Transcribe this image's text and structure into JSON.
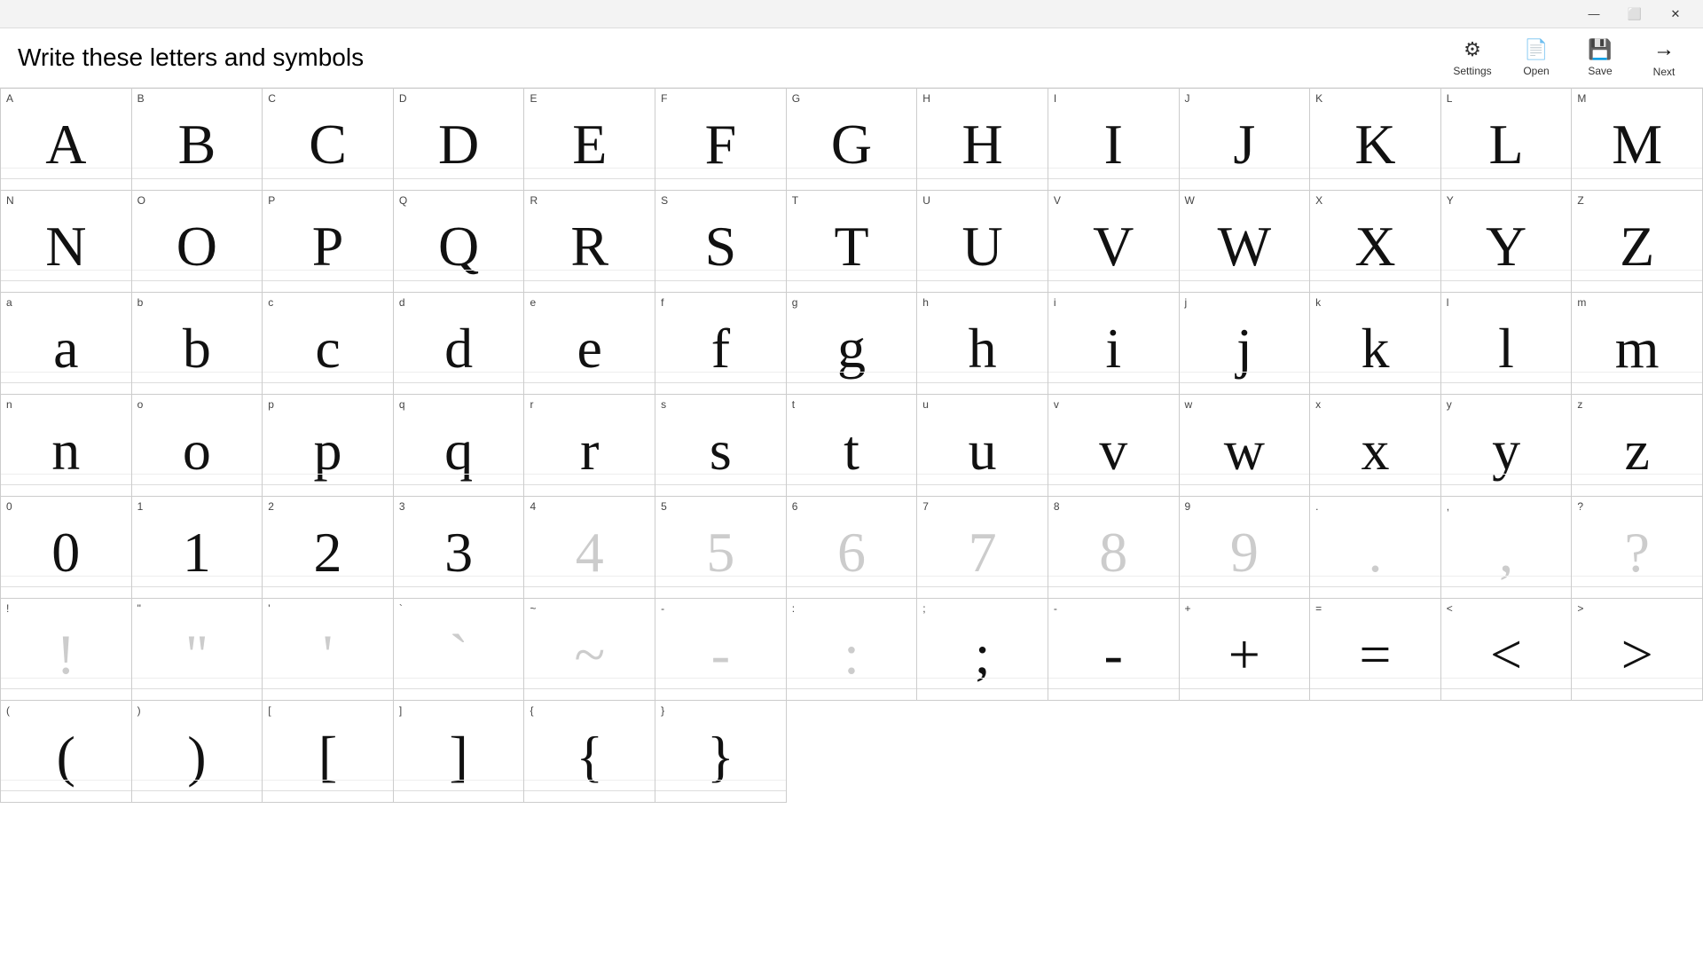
{
  "window": {
    "title": "Write these letters and symbols",
    "titlebar": {
      "minimize": "—",
      "maximize": "⬜",
      "close": "✕"
    }
  },
  "toolbar": {
    "settings_label": "Settings",
    "open_label": "Open",
    "save_label": "Save",
    "next_label": "Next"
  },
  "cells": [
    {
      "label": "A",
      "glyph": "A",
      "faded": false
    },
    {
      "label": "B",
      "glyph": "B",
      "faded": false
    },
    {
      "label": "C",
      "glyph": "C",
      "faded": false
    },
    {
      "label": "D",
      "glyph": "D",
      "faded": false
    },
    {
      "label": "E",
      "glyph": "E",
      "faded": false
    },
    {
      "label": "F",
      "glyph": "F",
      "faded": false
    },
    {
      "label": "G",
      "glyph": "G",
      "faded": false
    },
    {
      "label": "H",
      "glyph": "H",
      "faded": false
    },
    {
      "label": "I",
      "glyph": "I",
      "faded": false
    },
    {
      "label": "J",
      "glyph": "J",
      "faded": false
    },
    {
      "label": "K",
      "glyph": "K",
      "faded": false
    },
    {
      "label": "L",
      "glyph": "L",
      "faded": false
    },
    {
      "label": "M",
      "glyph": "M",
      "faded": false
    },
    {
      "label": "N",
      "glyph": "N",
      "faded": false
    },
    {
      "label": "O",
      "glyph": "O",
      "faded": false
    },
    {
      "label": "P",
      "glyph": "P",
      "faded": false
    },
    {
      "label": "Q",
      "glyph": "Q",
      "faded": false
    },
    {
      "label": "R",
      "glyph": "R",
      "faded": false
    },
    {
      "label": "S",
      "glyph": "S",
      "faded": false
    },
    {
      "label": "T",
      "glyph": "T",
      "faded": false
    },
    {
      "label": "U",
      "glyph": "U",
      "faded": false
    },
    {
      "label": "V",
      "glyph": "V",
      "faded": false
    },
    {
      "label": "W",
      "glyph": "W",
      "faded": false
    },
    {
      "label": "X",
      "glyph": "X",
      "faded": false
    },
    {
      "label": "Y",
      "glyph": "Y",
      "faded": false
    },
    {
      "label": "Z",
      "glyph": "Z",
      "faded": false
    },
    {
      "label": "a",
      "glyph": "a",
      "faded": false
    },
    {
      "label": "b",
      "glyph": "b",
      "faded": false
    },
    {
      "label": "c",
      "glyph": "c",
      "faded": false
    },
    {
      "label": "d",
      "glyph": "d",
      "faded": false
    },
    {
      "label": "e",
      "glyph": "e",
      "faded": false
    },
    {
      "label": "f",
      "glyph": "f",
      "faded": false
    },
    {
      "label": "g",
      "glyph": "g",
      "faded": false
    },
    {
      "label": "h",
      "glyph": "h",
      "faded": false
    },
    {
      "label": "i",
      "glyph": "i",
      "faded": false
    },
    {
      "label": "j",
      "glyph": "j",
      "faded": false
    },
    {
      "label": "k",
      "glyph": "k",
      "faded": false
    },
    {
      "label": "l",
      "glyph": "l",
      "faded": false
    },
    {
      "label": "m",
      "glyph": "m",
      "faded": false
    },
    {
      "label": "n",
      "glyph": "n",
      "faded": false
    },
    {
      "label": "o",
      "glyph": "o",
      "faded": false
    },
    {
      "label": "p",
      "glyph": "p",
      "faded": false
    },
    {
      "label": "q",
      "glyph": "q",
      "faded": false
    },
    {
      "label": "r",
      "glyph": "r",
      "faded": false
    },
    {
      "label": "s",
      "glyph": "s",
      "faded": false
    },
    {
      "label": "t",
      "glyph": "t",
      "faded": false
    },
    {
      "label": "u",
      "glyph": "u",
      "faded": false
    },
    {
      "label": "v",
      "glyph": "v",
      "faded": false
    },
    {
      "label": "w",
      "glyph": "w",
      "faded": false
    },
    {
      "label": "x",
      "glyph": "x",
      "faded": false
    },
    {
      "label": "y",
      "glyph": "y",
      "faded": false
    },
    {
      "label": "z",
      "glyph": "z",
      "faded": false
    },
    {
      "label": "0",
      "glyph": "0",
      "faded": false
    },
    {
      "label": "1",
      "glyph": "1",
      "faded": false
    },
    {
      "label": "2",
      "glyph": "2",
      "faded": false
    },
    {
      "label": "3",
      "glyph": "3",
      "faded": false
    },
    {
      "label": "4",
      "glyph": "4",
      "faded": true
    },
    {
      "label": "5",
      "glyph": "5",
      "faded": true
    },
    {
      "label": "6",
      "glyph": "6",
      "faded": true
    },
    {
      "label": "7",
      "glyph": "7",
      "faded": true
    },
    {
      "label": "8",
      "glyph": "8",
      "faded": true
    },
    {
      "label": "9",
      "glyph": "9",
      "faded": true
    },
    {
      "label": ".",
      "glyph": ".",
      "faded": true
    },
    {
      "label": ",",
      "glyph": ",",
      "faded": true
    },
    {
      "label": "?",
      "glyph": "?",
      "faded": true
    },
    {
      "label": "!",
      "glyph": "!",
      "faded": true
    },
    {
      "label": "\"",
      "glyph": "\"",
      "faded": true
    },
    {
      "label": "'",
      "glyph": "'",
      "faded": true
    },
    {
      "label": "`",
      "glyph": "`",
      "faded": true
    },
    {
      "label": "~",
      "glyph": "~",
      "faded": true
    },
    {
      "label": "-",
      "glyph": "-",
      "faded": true
    },
    {
      "label": ":",
      "glyph": ":",
      "faded": true
    },
    {
      "label": ";",
      "glyph": ";",
      "faded": false
    },
    {
      "label": "-",
      "glyph": "-",
      "faded": false
    },
    {
      "label": "+",
      "glyph": "+",
      "faded": false
    },
    {
      "label": "=",
      "glyph": "=",
      "faded": false
    },
    {
      "label": "<",
      "glyph": "<",
      "faded": false
    },
    {
      "label": ">",
      "glyph": ">",
      "faded": false
    },
    {
      "label": "(",
      "glyph": "(",
      "faded": false
    },
    {
      "label": ")",
      "glyph": ")",
      "faded": false
    },
    {
      "label": "[",
      "glyph": "[",
      "faded": false
    },
    {
      "label": "]",
      "glyph": "]",
      "faded": false
    },
    {
      "label": "{",
      "glyph": "{",
      "faded": false
    },
    {
      "label": "}",
      "glyph": "}",
      "faded": false
    }
  ]
}
